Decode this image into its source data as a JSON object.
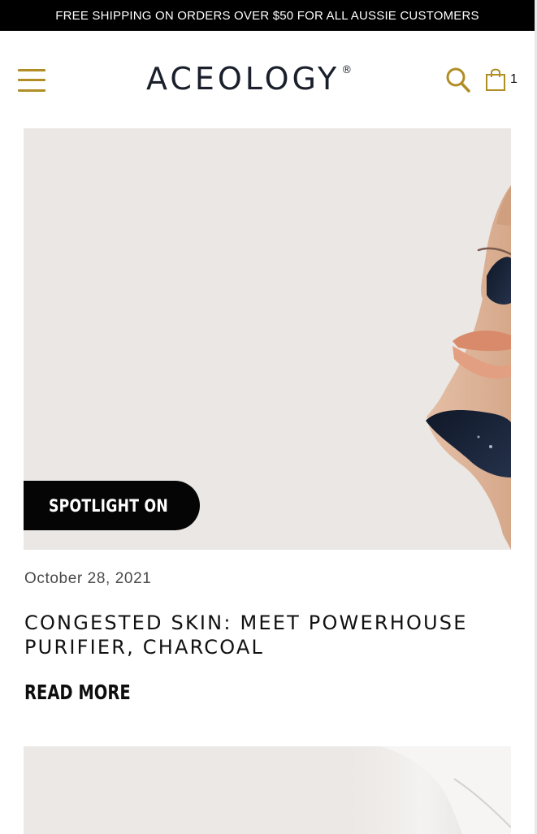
{
  "announcement": {
    "text": "FREE SHIPPING ON ORDERS OVER $50 FOR ALL AUSSIE CUSTOMERS"
  },
  "header": {
    "logo_text": "ACEOLOGY",
    "logo_mark": "®",
    "cart_count": "1",
    "icons": {
      "menu": "hamburger-menu-icon",
      "search": "search-icon",
      "cart": "shopping-bag-icon"
    }
  },
  "article": {
    "badge": "SPOTLIGHT ON",
    "date": "October 28, 2021",
    "title": "CONGESTED SKIN: MEET POWERHOUSE PURIFIER, CHARCOAL",
    "read_more": "READ MORE"
  },
  "colors": {
    "accent": "#b08d25",
    "badge_bg": "#050505",
    "image_bg": "#ebe7e4",
    "announcement_bg": "#000000"
  }
}
